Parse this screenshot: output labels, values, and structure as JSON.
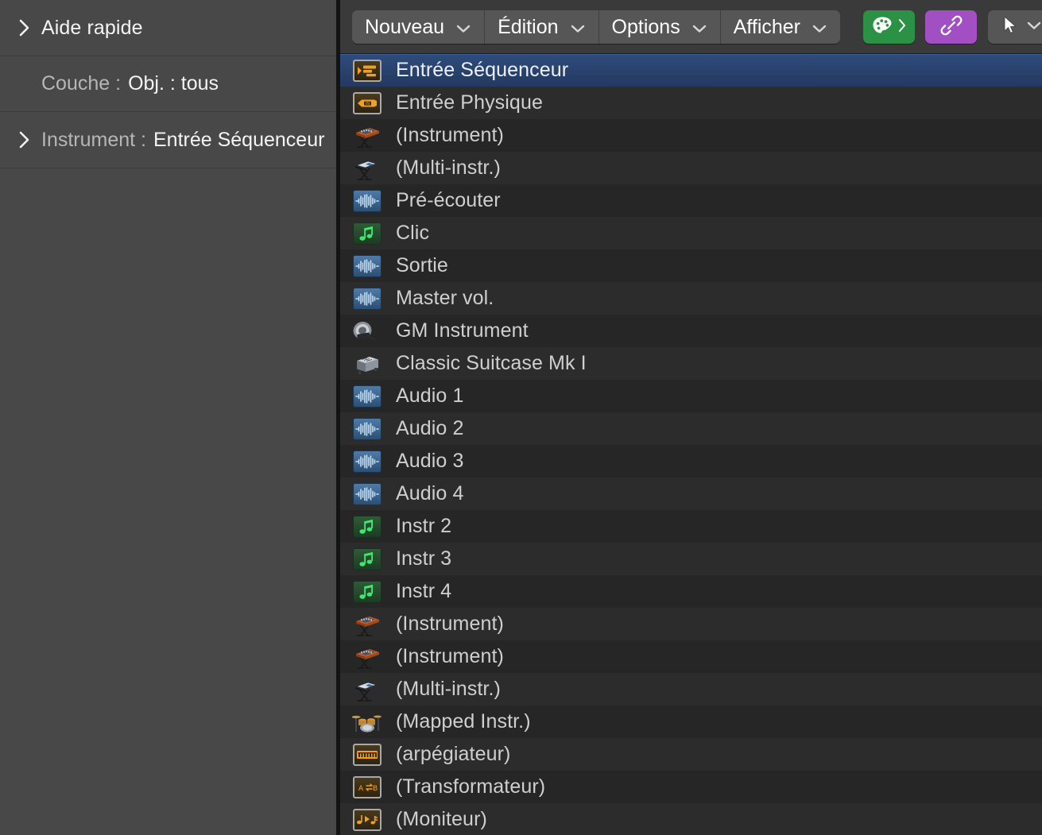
{
  "inspector": {
    "quick_help": {
      "label": "Aide rapide",
      "disclosure_icon": "chevron-right-icon"
    },
    "layer": {
      "label": "Couche :",
      "value": "Obj. : tous"
    },
    "instrument": {
      "label": "Instrument :",
      "value": "Entrée Séquenceur",
      "disclosure_icon": "chevron-right-icon"
    }
  },
  "toolbar": {
    "menus": [
      {
        "label": "Nouveau",
        "icon": "chevron-down-icon"
      },
      {
        "label": "Édition",
        "icon": "chevron-down-icon"
      },
      {
        "label": "Options",
        "icon": "chevron-down-icon"
      },
      {
        "label": "Afficher",
        "icon": "chevron-down-icon"
      }
    ],
    "palette_button": {
      "icon": "palette-icon",
      "secondary_icon": "chevron-right-icon",
      "color": "#2b9145"
    },
    "link_button": {
      "icon": "link-chain-icon",
      "color": "#a24fc4"
    },
    "pointer_button": {
      "icon": "pointer-arrow-icon",
      "secondary_icon": "chevron-down-icon"
    }
  },
  "list": {
    "selected_index": 0,
    "selection_color": "#2e4c7d",
    "items": [
      {
        "label": "Entrée Séquenceur",
        "icon": "sequencer-input-icon"
      },
      {
        "label": "Entrée Physique",
        "icon": "physical-input-icon"
      },
      {
        "label": "(Instrument)",
        "icon": "keyboard-instrument-icon"
      },
      {
        "label": "(Multi-instr.)",
        "icon": "multi-instrument-icon"
      },
      {
        "label": "Pré-écouter",
        "icon": "audio-waveform-icon"
      },
      {
        "label": "Clic",
        "icon": "music-note-icon"
      },
      {
        "label": "Sortie",
        "icon": "audio-waveform-icon"
      },
      {
        "label": "Master vol.",
        "icon": "audio-waveform-icon"
      },
      {
        "label": "GM Instrument",
        "icon": "speaker-icon"
      },
      {
        "label": "Classic Suitcase Mk I",
        "icon": "suitcase-piano-icon"
      },
      {
        "label": "Audio 1",
        "icon": "audio-waveform-icon"
      },
      {
        "label": "Audio 2",
        "icon": "audio-waveform-icon"
      },
      {
        "label": "Audio 3",
        "icon": "audio-waveform-icon"
      },
      {
        "label": "Audio 4",
        "icon": "audio-waveform-icon"
      },
      {
        "label": "Instr 2",
        "icon": "music-note-icon"
      },
      {
        "label": "Instr 3",
        "icon": "music-note-icon"
      },
      {
        "label": "Instr 4",
        "icon": "music-note-icon"
      },
      {
        "label": "(Instrument)",
        "icon": "keyboard-instrument-icon"
      },
      {
        "label": "(Instrument)",
        "icon": "keyboard-instrument-icon"
      },
      {
        "label": "(Multi-instr.)",
        "icon": "multi-instrument-icon"
      },
      {
        "label": "(Mapped Instr.)",
        "icon": "drum-kit-icon"
      },
      {
        "label": "(arpégiateur)",
        "icon": "arpeggiator-icon"
      },
      {
        "label": "(Transformateur)",
        "icon": "transformer-icon"
      },
      {
        "label": "(Moniteur)",
        "icon": "monitor-icon"
      }
    ]
  }
}
